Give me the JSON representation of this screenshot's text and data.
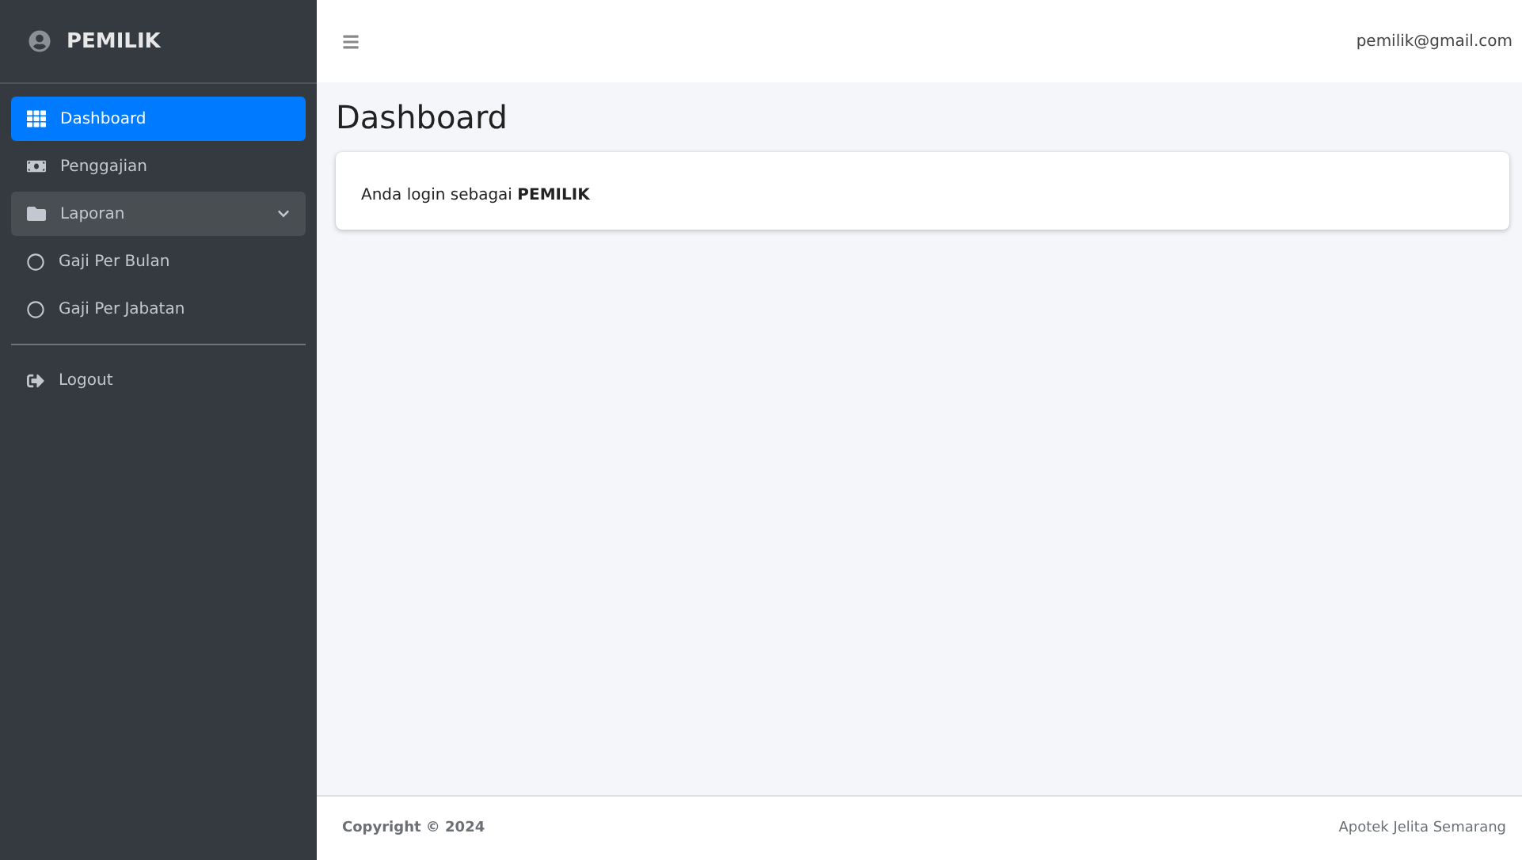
{
  "brand": {
    "title": "PEMILIK"
  },
  "nav": [
    {
      "label": "Dashboard",
      "selected": true
    },
    {
      "label": "Penggajian",
      "selected": false
    },
    {
      "label": "Laporan",
      "selected": false,
      "expanded": true,
      "children": [
        {
          "label": "Gaji Per Bulan",
          "selected": false
        },
        {
          "label": "Gaji Per Jabatan",
          "selected": false
        }
      ]
    }
  ],
  "logout": {
    "label": "Logout"
  },
  "topbar": {
    "user": "pemilik@gmail.com"
  },
  "page_title": "Dashboard",
  "info_card": {
    "text": "Anda login sebagai **PEMILIK**"
  },
  "footer": {
    "copyright": "Copyright © 2024",
    "credit": "Apotek Jelita Semarang"
  }
}
